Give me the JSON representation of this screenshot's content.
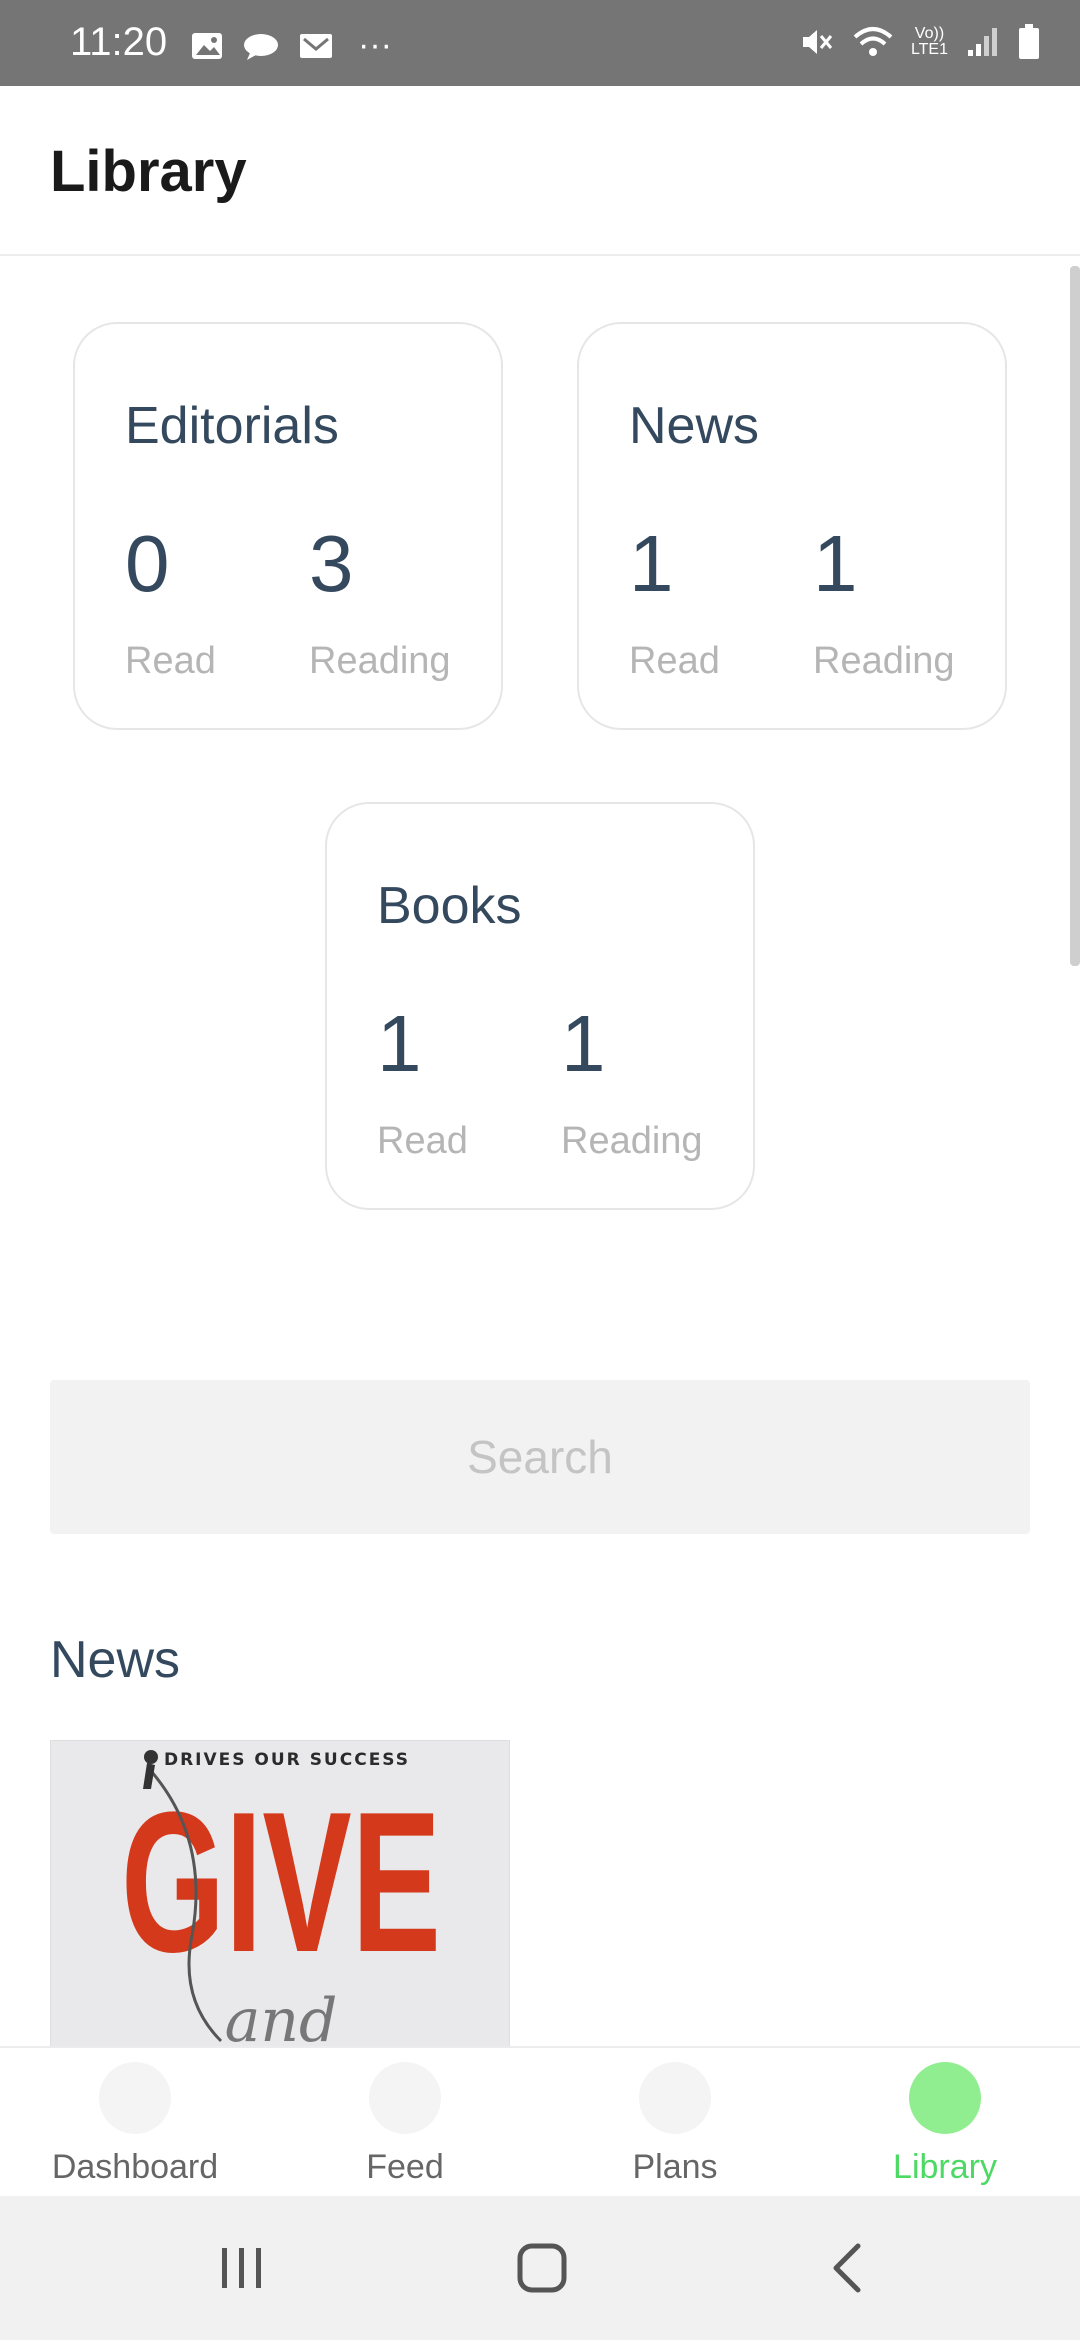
{
  "status_bar": {
    "time": "11:20",
    "left_icons": [
      "image-icon",
      "cloud-chat-icon",
      "mail-icon",
      "more-icon"
    ],
    "right_icons": [
      "mute-icon",
      "wifi-icon",
      "volte-icon",
      "signal-icon",
      "battery-icon"
    ],
    "more_glyph": "···",
    "volte_text": "Vo))",
    "lte_text": "LTE1"
  },
  "header": {
    "title": "Library"
  },
  "stats": [
    {
      "title": "Editorials",
      "read": "0",
      "read_label": "Read",
      "reading": "3",
      "reading_label": "Reading"
    },
    {
      "title": "News",
      "read": "1",
      "read_label": "Read",
      "reading": "1",
      "reading_label": "Reading"
    },
    {
      "title": "Books",
      "read": "1",
      "read_label": "Read",
      "reading": "1",
      "reading_label": "Reading"
    }
  ],
  "search": {
    "placeholder": "Search"
  },
  "news_section": {
    "title": "News",
    "cover": {
      "tagline": "DRIVES OUR SUCCESS",
      "title_word": "GIVE",
      "script_word": "and"
    }
  },
  "bottom_nav": {
    "items": [
      {
        "label": "Dashboard"
      },
      {
        "label": "Feed"
      },
      {
        "label": "Plans"
      },
      {
        "label": "Library"
      }
    ],
    "active": "Library",
    "active_color": "#4cd964"
  },
  "system_nav": {
    "icons": [
      "recents-icon",
      "home-icon",
      "back-icon"
    ]
  }
}
